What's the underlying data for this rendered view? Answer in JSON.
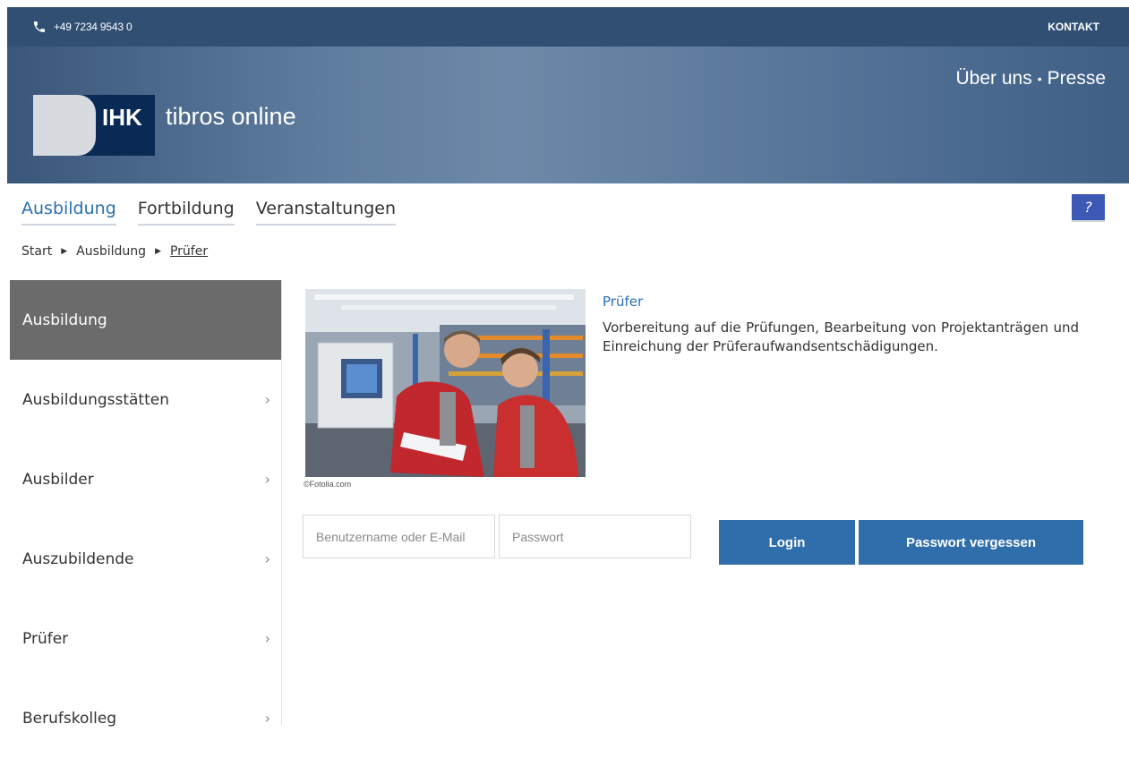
{
  "topbar": {
    "phone": "+49 7234 9543 0",
    "contact": "KONTAKT"
  },
  "header": {
    "logo_text": "IHK",
    "app_name": "tibros online",
    "nav": [
      {
        "label": "Über uns"
      },
      {
        "label": "Presse"
      }
    ],
    "nav_separator": "•"
  },
  "main_nav": {
    "tabs": [
      {
        "label": "Ausbildung",
        "active": true
      },
      {
        "label": "Fortbildung",
        "active": false
      },
      {
        "label": "Veranstaltungen",
        "active": false
      }
    ],
    "help_label": "?"
  },
  "breadcrumb": {
    "items": [
      "Start",
      "Ausbildung",
      "Prüfer"
    ]
  },
  "sidebar": {
    "items": [
      {
        "label": "Ausbildung",
        "active": true
      },
      {
        "label": "Ausbildungsstätten",
        "chevron": "›"
      },
      {
        "label": "Ausbilder",
        "chevron": "›"
      },
      {
        "label": "Auszubildende",
        "chevron": "›"
      },
      {
        "label": "Prüfer",
        "chevron": "›"
      },
      {
        "label": "Berufskolleg",
        "chevron": "›"
      }
    ]
  },
  "content": {
    "image_credit": "©Fotolia.com",
    "title": "Prüfer",
    "description": "Vorbereitung auf die Prüfungen, Bearbeitung von Projektanträgen und Einreichung der Prüferaufwandsentschädigungen."
  },
  "login": {
    "username_placeholder": "Benutzername oder E-Mail",
    "password_placeholder": "Passwort",
    "login_label": "Login",
    "forgot_label": "Passwort vergessen"
  },
  "colors": {
    "header_bar": "#304f72",
    "accent_blue": "#2f6eaa",
    "logo_navy": "#0a2a56",
    "sidebar_active": "#6b6b6b",
    "help_badge": "#3d58b5"
  },
  "icons": {
    "phone": "phone-icon",
    "chevron": "chevron-right-icon",
    "breadcrumb_separator": "triangle-right-icon"
  }
}
